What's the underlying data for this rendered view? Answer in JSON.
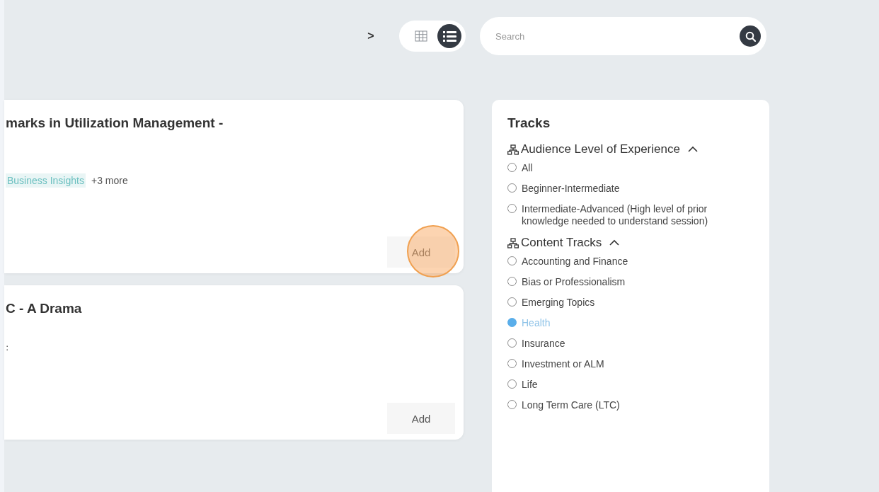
{
  "toolbar": {
    "next": ">",
    "views": [
      {
        "kind": "grid",
        "selected": false
      },
      {
        "kind": "list",
        "selected": true
      }
    ],
    "search": {
      "placeholder": "Search"
    }
  },
  "sessions": [
    {
      "title": "marks in Utilization Management -",
      "tags": [
        "Business Insights"
      ],
      "more": "+3 more",
      "button": {
        "label": "Add",
        "click_marker": true
      }
    },
    {
      "title": "C - A Drama",
      "meta": ":",
      "button": {
        "label": "Add",
        "click_marker": false
      }
    }
  ],
  "tracks": {
    "title": "Tracks",
    "groups": [
      {
        "label": "Audience Level of Experience",
        "expanded": true,
        "options": [
          {
            "label": "All",
            "selected": false
          },
          {
            "label": "Beginner-Intermediate",
            "selected": false
          },
          {
            "label": "Intermediate-Advanced (High level of prior knowledge needed to understand session)",
            "selected": false
          }
        ]
      },
      {
        "label": "Content Tracks",
        "expanded": true,
        "options": [
          {
            "label": "Accounting and Finance",
            "selected": false
          },
          {
            "label": "Bias or Professionalism",
            "selected": false
          },
          {
            "label": "Emerging Topics",
            "selected": false
          },
          {
            "label": "Health",
            "selected": true
          },
          {
            "label": "Insurance",
            "selected": false
          },
          {
            "label": "Investment or ALM",
            "selected": false
          },
          {
            "label": "Life",
            "selected": false
          },
          {
            "label": "Long Term Care (LTC)",
            "selected": false
          }
        ]
      }
    ]
  }
}
